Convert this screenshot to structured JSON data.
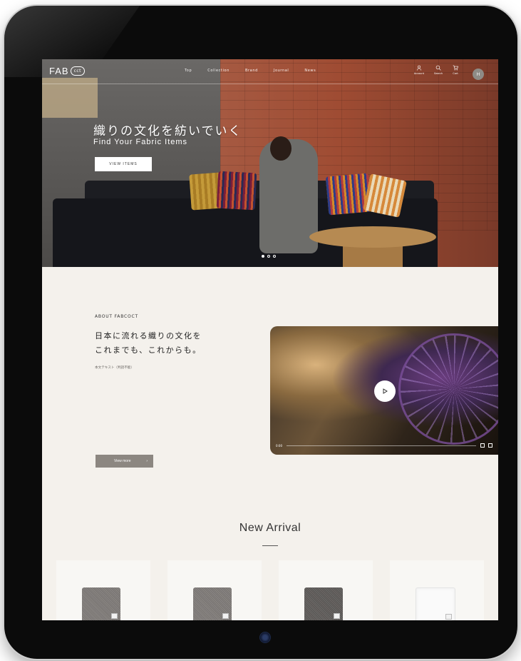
{
  "header": {
    "logo_text": "FAB",
    "logo_badge": "cct",
    "menu": [
      "Top",
      "Collection",
      "Brand",
      "Journal",
      "News"
    ],
    "actions": [
      {
        "icon": "user-icon",
        "label": "Account"
      },
      {
        "icon": "search-icon",
        "label": "Search"
      },
      {
        "icon": "cart-icon",
        "label": "Cart"
      }
    ],
    "avatar": "H"
  },
  "hero": {
    "title": "織りの文化を紡いでいく",
    "subtitle": "Find Your Fabric Items",
    "button_label": "VIEW ITEMS"
  },
  "about": {
    "label": "ABOUT FABCOCT",
    "title": "日本に流れる織りの文化を\nこれまでも、これからも。",
    "body": "本文テキスト（判読不能）",
    "button_label": "View more",
    "button_arrow": "›"
  },
  "video": {
    "time": "0:00"
  },
  "new_arrival": {
    "title": "New Arrival"
  },
  "colors": {
    "background": "#f4f1ec",
    "button_gray": "#8c8781",
    "brick": "#9f4c33"
  }
}
